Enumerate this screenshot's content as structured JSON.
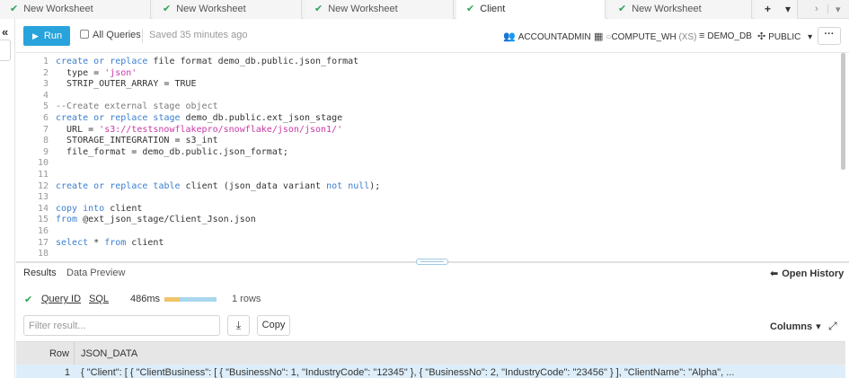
{
  "tabs": [
    {
      "label": "New Worksheet",
      "active": false
    },
    {
      "label": "New Worksheet",
      "active": false
    },
    {
      "label": "New Worksheet",
      "active": false
    },
    {
      "label": "Client",
      "active": true
    },
    {
      "label": "New Worksheet",
      "active": false
    }
  ],
  "tab_controls": {
    "plus": "+",
    "dropdown": "▾",
    "next": "›",
    "more": "▾"
  },
  "toolbar": {
    "run_label": "Run",
    "all_queries_label": "All Queries",
    "saved_text": "Saved 35 minutes ago",
    "role": "ACCOUNTADMIN",
    "warehouse": "COMPUTE_WH",
    "warehouse_size": "(XS)",
    "database": "DEMO_DB",
    "schema": "PUBLIC",
    "more_label": "···"
  },
  "editor": {
    "lines": [
      {
        "n": "1",
        "code": "create or replace file format demo_db.public.json_format"
      },
      {
        "n": "2",
        "code": "  type = 'json'"
      },
      {
        "n": "3",
        "code": "  STRIP_OUTER_ARRAY = TRUE"
      },
      {
        "n": "4",
        "code": ""
      },
      {
        "n": "5",
        "code": "--Create external stage object"
      },
      {
        "n": "6",
        "code": "create or replace stage demo_db.public.ext_json_stage"
      },
      {
        "n": "7",
        "code": "  URL = 's3://testsnowflakepro/snowflake/json/json1/'"
      },
      {
        "n": "8",
        "code": "  STORAGE_INTEGRATION = s3_int"
      },
      {
        "n": "9",
        "code": "  file_format = demo_db.public.json_format;"
      },
      {
        "n": "10",
        "code": ""
      },
      {
        "n": "11",
        "code": ""
      },
      {
        "n": "12",
        "code": "create or replace table client (json_data variant not null);"
      },
      {
        "n": "13",
        "code": ""
      },
      {
        "n": "14",
        "code": "copy into client"
      },
      {
        "n": "15",
        "code": "from @ext_json_stage/Client_Json.json"
      },
      {
        "n": "16",
        "code": ""
      },
      {
        "n": "17",
        "code": "select * from client"
      },
      {
        "n": "18",
        "code": ""
      }
    ]
  },
  "results": {
    "tab_results": "Results",
    "tab_preview": "Data Preview",
    "open_history": "Open History",
    "query_id_label": "Query ID",
    "sql_label": "SQL",
    "duration": "486ms",
    "progress_fraction": 0.3,
    "rows_text": "1 rows",
    "filter_placeholder": "Filter result...",
    "copy_label": "Copy",
    "columns_label": "Columns",
    "table": {
      "headers": [
        "Row",
        "JSON_DATA"
      ],
      "rows": [
        [
          "1",
          "{ \"Client\": [ { \"ClientBusiness\": [ { \"BusinessNo\": 1, \"IndustryCode\": \"12345\" }, { \"BusinessNo\": 2, \"IndustryCode\": \"23456\" } ], \"ClientName\": \"Alpha\", ..."
        ]
      ]
    }
  },
  "colors": {
    "accent": "#29a3dc",
    "success": "#2fa35a",
    "keyword": "#3a7fd0",
    "string": "#c838a6"
  },
  "icons": {
    "collapse": "double-chevron-left-icon",
    "run": "play-icon",
    "role": "users-icon",
    "warehouse": "grid-icon",
    "database": "database-icon",
    "schema": "schema-icon",
    "download": "download-icon",
    "expand": "expand-icon",
    "open_history": "arrow-left-icon"
  }
}
